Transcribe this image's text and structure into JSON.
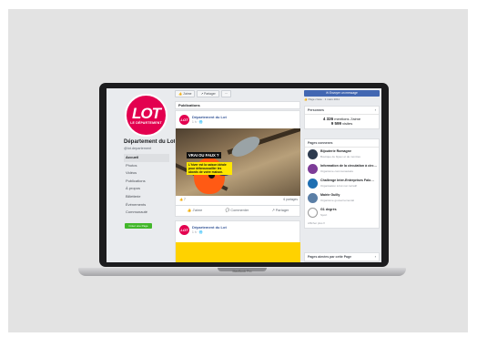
{
  "device": {
    "label": "MacBook Pro"
  },
  "page": {
    "logo_text": "LOT",
    "logo_sub": "LE DÉPARTEMENT",
    "name": "Département du Lot",
    "handle": "@lot.departement",
    "nav": [
      "Accueil",
      "Photos",
      "Vidéos",
      "Publications",
      "À propos",
      "Billetterie",
      "Événements",
      "Communauté"
    ],
    "create_button": "Créer une Page"
  },
  "actionbar": {
    "like": "👍 J'aime",
    "share": "↗ Partager",
    "more": "···"
  },
  "publications": {
    "heading": "Publications"
  },
  "post": {
    "author": "Département du Lot",
    "time": "1 h · 🌐",
    "quiz_title": "VRAI OU FAUX ?",
    "quiz_body": "L'hiver est la saison idéale pour débroussailler les abords de votre maison.",
    "reactions": "👍 7",
    "shares": "6 partages",
    "like": "J'aime",
    "comment": "Commenter",
    "share": "Partager"
  },
  "post2": {
    "author": "Département du Lot",
    "time": "1 h · 🌐"
  },
  "sidebar": {
    "message_button": "Envoyer un message",
    "likes_top": "👍 Page créée · 1 mars 2011",
    "people": {
      "heading": "Personnes",
      "likes_count": "4 326",
      "likes_label": "mentions J'aime",
      "visits_count": "9 599",
      "visits_label": "visites"
    },
    "related": {
      "heading": "Pages connexes",
      "items": [
        {
          "name": "Bijouterie Romagne",
          "sub": "Boutique de bijoux et de montres",
          "color": "#2d3b4f"
        },
        {
          "name": "Information de la circulation à circ…",
          "sub": "Organisme communautaire",
          "color": "#7d3c98"
        },
        {
          "name": "Challenge Inter-Entreprises Falo…",
          "sub": "Organisation à but non lucratif",
          "color": "#1f6fb2"
        },
        {
          "name": "Mairie Guilly",
          "sub": "Organisme gouvernemental",
          "color": "#5b7fa6"
        },
        {
          "name": "G1 degrés",
          "sub": "Sport",
          "color": "#ffffff"
        }
      ],
      "more": "Afficher plus ▾"
    },
    "liked_by": {
      "heading": "Pages aimées par cette Page"
    }
  }
}
